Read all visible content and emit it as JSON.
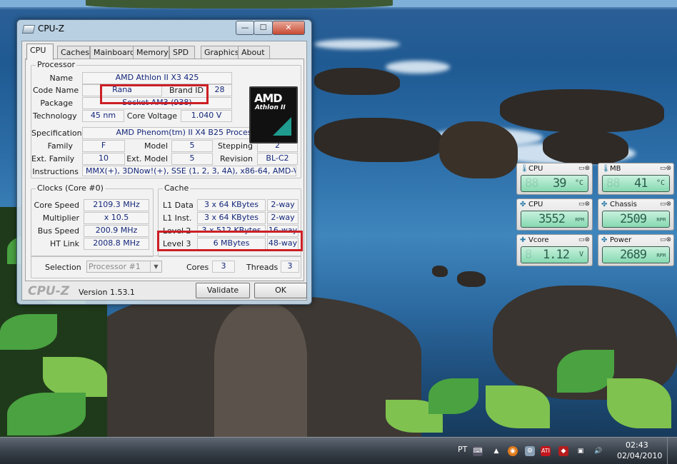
{
  "window": {
    "title": "CPU-Z",
    "controls": {
      "minimize": "—",
      "maximize": "☐",
      "close": "✕"
    }
  },
  "tabs": [
    "CPU",
    "Caches",
    "Mainboard",
    "Memory",
    "SPD",
    "Graphics",
    "About"
  ],
  "processor": {
    "section_label": "Processor",
    "name_label": "Name",
    "name": "AMD Athlon II X3 425",
    "codename_label": "Code Name",
    "codename": "Rana",
    "brandid_label": "Brand ID",
    "brandid": "28",
    "package_label": "Package",
    "package": "Socket AM3 (938)",
    "technology_label": "Technology",
    "technology": "45 nm",
    "voltage_label": "Core Voltage",
    "voltage": "1.040 V",
    "spec_label": "Specification",
    "spec": "AMD Phenom(tm) II X4 B25 Processor",
    "family_label": "Family",
    "family": "F",
    "model_label": "Model",
    "model": "5",
    "stepping_label": "Stepping",
    "stepping": "2",
    "extfamily_label": "Ext. Family",
    "extfamily": "10",
    "extmodel_label": "Ext. Model",
    "extmodel": "5",
    "revision_label": "Revision",
    "revision": "BL-C2",
    "instructions_label": "Instructions",
    "instructions": "MMX(+), 3DNow!(+), SSE (1, 2, 3, 4A), x86-64, AMD-V",
    "logo": {
      "brand": "AMD",
      "sub": "Athlon II"
    }
  },
  "clocks": {
    "section_label": "Clocks (Core #0)",
    "core_speed_label": "Core Speed",
    "core_speed": "2109.3 MHz",
    "multiplier_label": "Multiplier",
    "multiplier": "x 10.5",
    "bus_speed_label": "Bus Speed",
    "bus_speed": "200.9 MHz",
    "ht_link_label": "HT Link",
    "ht_link": "2008.8 MHz"
  },
  "cache": {
    "section_label": "Cache",
    "rows": [
      {
        "label": "L1 Data",
        "size": "3 x 64 KBytes",
        "way": "2-way"
      },
      {
        "label": "L1 Inst.",
        "size": "3 x 64 KBytes",
        "way": "2-way"
      },
      {
        "label": "Level 2",
        "size": "3 x 512 KBytes",
        "way": "16-way"
      },
      {
        "label": "Level 3",
        "size": "6 MBytes",
        "way": "48-way"
      }
    ]
  },
  "selection": {
    "label": "Selection",
    "value": "Processor #1",
    "cores_label": "Cores",
    "cores": "3",
    "threads_label": "Threads",
    "threads": "3"
  },
  "footer": {
    "brand": "CPU-Z",
    "version": "Version 1.53.1",
    "validate": "Validate",
    "ok": "OK"
  },
  "gadgets": [
    {
      "name": "CPU",
      "value": "39",
      "unit": "°C"
    },
    {
      "name": "MB",
      "value": "41",
      "unit": "°C"
    },
    {
      "name": "CPU",
      "value": "3552",
      "unit": "RPM"
    },
    {
      "name": "Chassis",
      "value": "2509",
      "unit": "RPM"
    },
    {
      "name": "Vcore",
      "value": "1.12",
      "unit": "V"
    },
    {
      "name": "Power",
      "value": "2689",
      "unit": "RPM"
    }
  ],
  "taskbar": {
    "language": "PT",
    "time": "02:43",
    "date": "02/04/2010"
  },
  "colors": {
    "highlight_red": "#cc1f25",
    "value_text": "#14277a",
    "lcd_green": "#86d9b1"
  }
}
